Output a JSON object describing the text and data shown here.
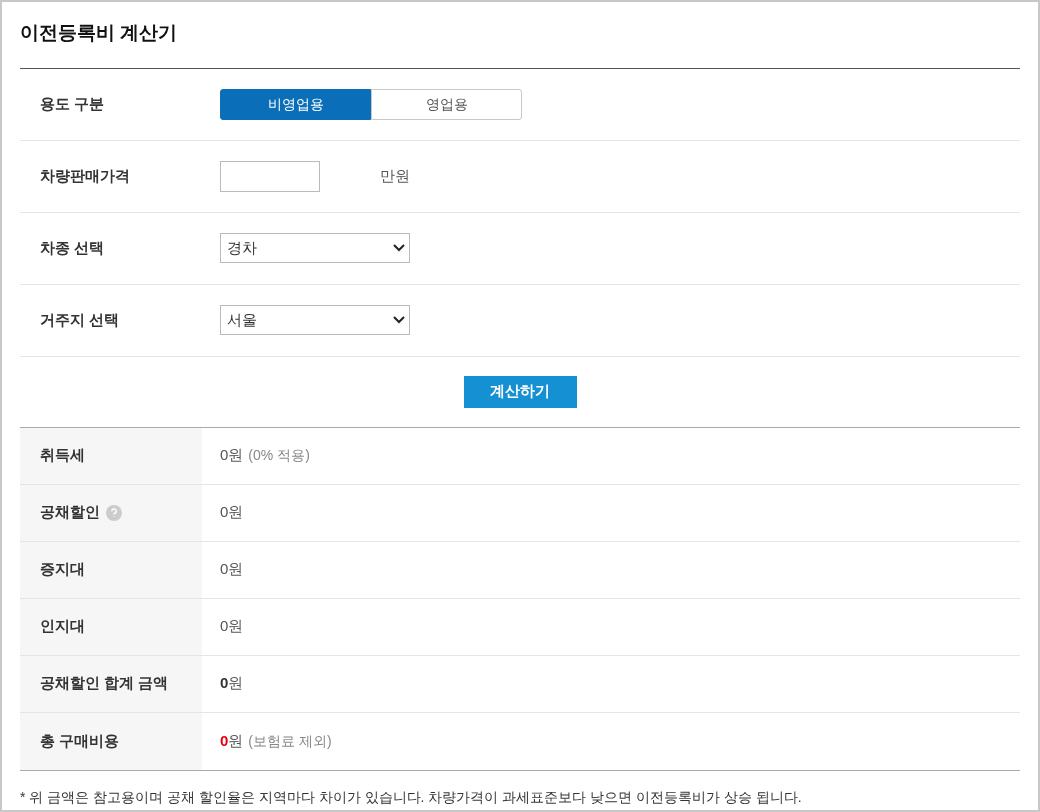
{
  "title": "이전등록비 계산기",
  "form": {
    "usage": {
      "label": "용도 구분",
      "options": [
        {
          "label": "비영업용",
          "selected": true
        },
        {
          "label": "영업용",
          "selected": false
        }
      ]
    },
    "price": {
      "label": "차량판매가격",
      "unit": "만원"
    },
    "car_type": {
      "label": "차종 선택",
      "value": "경차"
    },
    "region": {
      "label": "거주지 선택",
      "value": "서울"
    },
    "submit": "계산하기"
  },
  "results": [
    {
      "label": "취득세",
      "help": false,
      "kind": "plain",
      "amount": "0",
      "unit": "원",
      "note": "(0% 적용)"
    },
    {
      "label": "공채할인",
      "help": true,
      "kind": "plain",
      "amount": "0",
      "unit": "원"
    },
    {
      "label": "증지대",
      "help": false,
      "kind": "plain",
      "amount": "0",
      "unit": "원"
    },
    {
      "label": "인지대",
      "help": false,
      "kind": "plain",
      "amount": "0",
      "unit": "원"
    },
    {
      "label": "공채할인 합계 금액",
      "help": false,
      "kind": "bold",
      "amount": "0",
      "unit": "원"
    },
    {
      "label": "총 구매비용",
      "help": false,
      "kind": "red",
      "amount": "0",
      "unit": "원",
      "note": "(보험료 제외)"
    }
  ],
  "footnote": "* 위 금액은 참고용이며 공채 할인율은 지역마다 차이가 있습니다. 차량가격이 과세표준보다 낮으면 이전등록비가 상승 됩니다."
}
